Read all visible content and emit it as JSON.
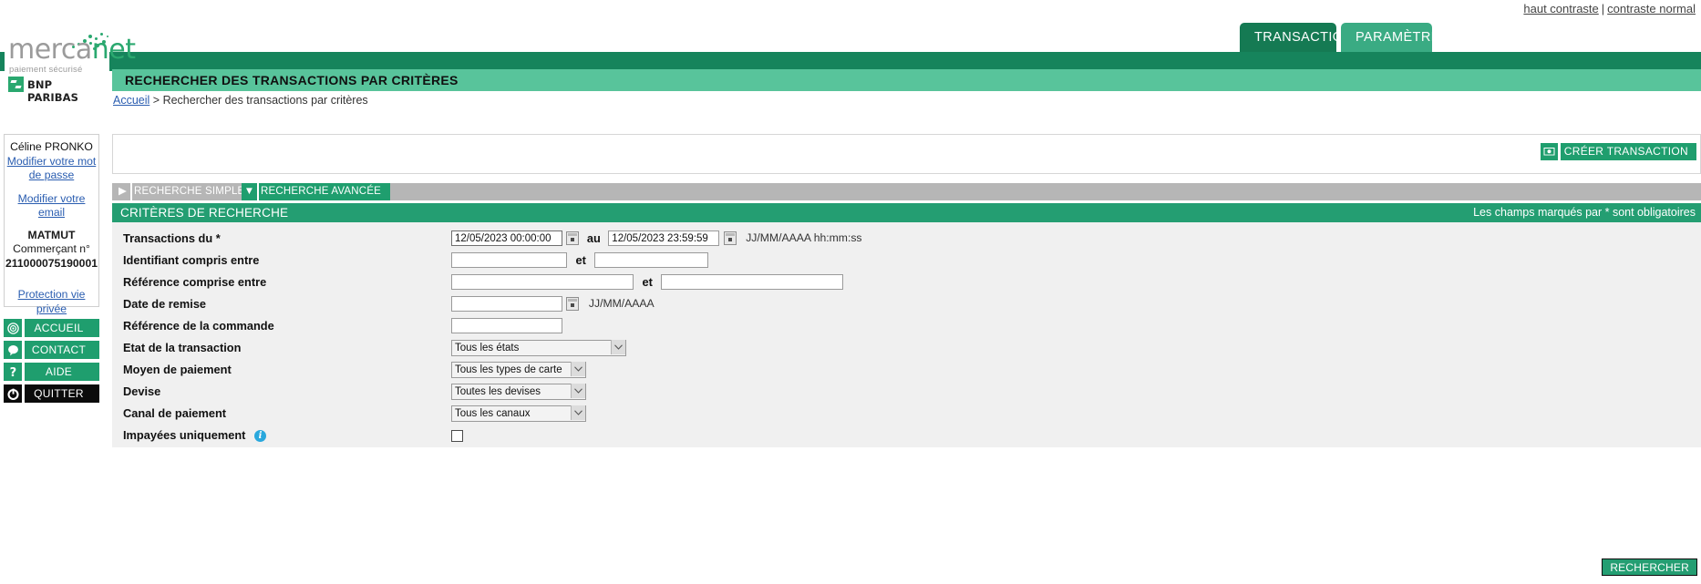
{
  "header": {
    "contrast_high": "haut contraste",
    "contrast_separator": "|",
    "contrast_normal": "contraste normal",
    "tabs": [
      {
        "label": "TRANSACTIONS",
        "active": true
      },
      {
        "label": "PARAMÈTRES",
        "active": false
      }
    ],
    "page_title": "RECHERCHER DES TRANSACTIONS PAR CRITÈRES"
  },
  "logo": {
    "word_part1": "merca",
    "word_part2": "net",
    "tagline": "paiement sécurisé",
    "bank": "BNP PARIBAS"
  },
  "breadcrumb": {
    "home": "Accueil",
    "separator": ">",
    "current": "Rechercher des transactions par critères"
  },
  "sidebar": {
    "user_name": "Céline PRONKO",
    "change_password": "Modifier votre mot de passe",
    "change_email": "Modifier votre email",
    "merchant_name": "MATMUT",
    "merchant_label": "Commerçant n°",
    "merchant_number": "211000075190001",
    "privacy": "Protection vie privée",
    "buttons": [
      {
        "label": "ACCUEIL",
        "icon": "target-icon"
      },
      {
        "label": "CONTACT",
        "icon": "speech-bubble-icon"
      },
      {
        "label": "AIDE",
        "icon": "question-mark-icon"
      },
      {
        "label": "QUITTER",
        "icon": "power-icon"
      }
    ]
  },
  "toolbar": {
    "create_transaction": "CRÉER TRANSACTION",
    "create_icon": "banknote-icon"
  },
  "search_tabs": [
    {
      "label": "RECHERCHE SIMPLE",
      "active": false,
      "arrow": "▶"
    },
    {
      "label": "RECHERCHE AVANCÉE",
      "active": true,
      "arrow": "▼"
    }
  ],
  "criteria": {
    "title": "CRITÈRES DE RECHERCHE",
    "required_note": "Les champs marqués par * sont obligatoires"
  },
  "form": {
    "transactions_du": {
      "label": "Transactions du *",
      "from_value": "12/05/2023 00:00:00",
      "middle": "au",
      "to_value": "12/05/2023 23:59:59",
      "format_hint": "JJ/MM/AAAA hh:mm:ss"
    },
    "identifiant": {
      "label": "Identifiant compris entre",
      "from_value": "",
      "middle": "et",
      "to_value": ""
    },
    "reference": {
      "label": "Référence comprise entre",
      "from_value": "",
      "middle": "et",
      "to_value": ""
    },
    "date_remise": {
      "label": "Date de remise",
      "value": "",
      "format_hint": "JJ/MM/AAAA"
    },
    "reference_commande": {
      "label": "Référence de la commande",
      "value": ""
    },
    "etat_transaction": {
      "label": "Etat de la transaction",
      "value": "Tous les états"
    },
    "moyen_paiement": {
      "label": "Moyen de paiement",
      "value": "Tous les types de carte"
    },
    "devise": {
      "label": "Devise",
      "value": "Toutes les devises"
    },
    "canal_paiement": {
      "label": "Canal de paiement",
      "value": "Tous les canaux"
    },
    "impayees": {
      "label": "Impayées uniquement",
      "info_icon": "info-icon",
      "checked": false
    }
  },
  "footer": {
    "search_button": "RECHERCHER"
  },
  "colors": {
    "brand_green": "#1f9e6e",
    "dark_green": "#157a53",
    "light_green": "#58c49b",
    "header_green": "#16845c",
    "tab_gray": "#b6b6b6",
    "panel_gray": "#f0f0f0",
    "link_blue": "#2a5db0",
    "info_blue": "#29a8dd"
  }
}
